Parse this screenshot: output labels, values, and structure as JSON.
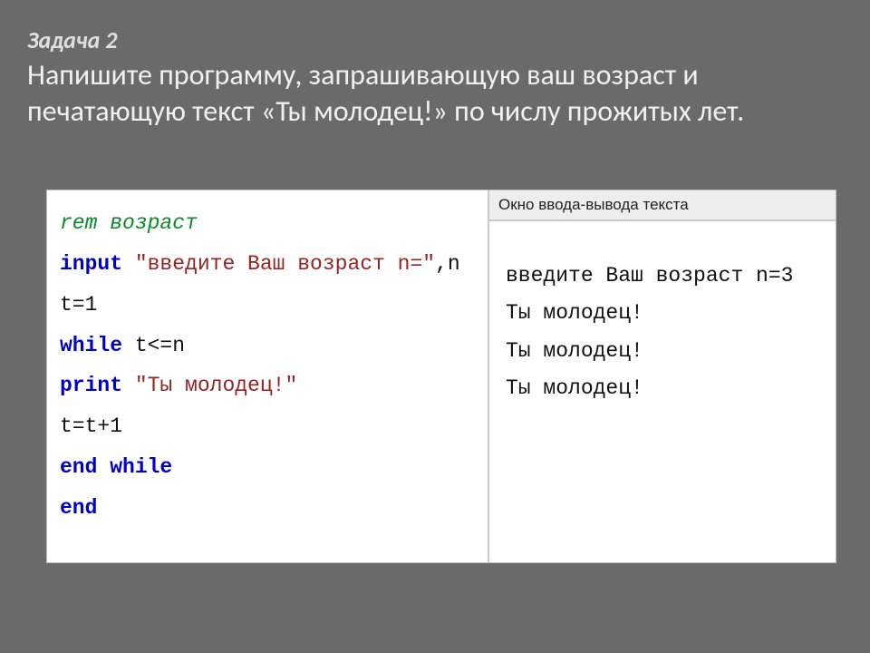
{
  "heading": {
    "task_no": "Задача 2",
    "task_text": "Напишите программу, запрашивающую ваш возраст и печатающую текст «Ты молодец!» по числу прожитых лет."
  },
  "code": {
    "rem_kw": "rem",
    "rem_text": " возраст",
    "input_kw": "input",
    "input_str": "\"введите Ваш возраст n=\"",
    "input_tail": ",n",
    "l_t1": "t=1",
    "while_kw": "while",
    "while_cond": " t<=n",
    "print_kw": "print",
    "print_str": "\"Ты молодец!\"",
    "l_tinc": "t=t+1",
    "endwhile_kw": "end while",
    "end_kw": "end"
  },
  "output": {
    "title": "Окно ввода-вывода текста",
    "lines": [
      "введите Ваш возраст n=3",
      "Ты молодец!",
      "Ты молодец!",
      "Ты молодец!"
    ]
  }
}
